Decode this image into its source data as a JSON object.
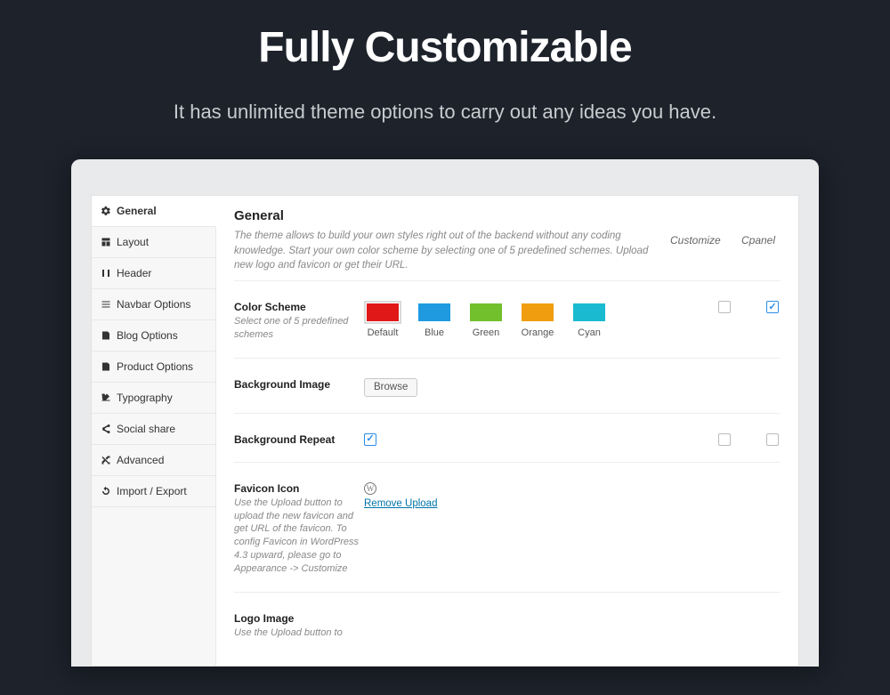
{
  "hero": {
    "title": "Fully Customizable",
    "subtitle": "It has unlimited theme options to carry out any ideas you have."
  },
  "sidebar": {
    "items": [
      {
        "label": "General"
      },
      {
        "label": "Layout"
      },
      {
        "label": "Header"
      },
      {
        "label": "Navbar Options"
      },
      {
        "label": "Blog Options"
      },
      {
        "label": "Product Options"
      },
      {
        "label": "Typography"
      },
      {
        "label": "Social share"
      },
      {
        "label": "Advanced"
      },
      {
        "label": "Import / Export"
      }
    ]
  },
  "content": {
    "heading": "General",
    "description": "The theme allows to build your own styles right out of the backend without any coding knowledge. Start your own color scheme by selecting one of 5 predefined schemes. Upload new logo and favicon or get their URL.",
    "col_customize": "Customize",
    "col_cpanel": "Cpanel",
    "color_scheme": {
      "title": "Color Scheme",
      "hint": "Select one of 5 predefined schemes",
      "swatches": [
        {
          "label": "Default",
          "color": "#e11818",
          "selected": true
        },
        {
          "label": "Blue",
          "color": "#1f9ae0"
        },
        {
          "label": "Green",
          "color": "#72c02c"
        },
        {
          "label": "Orange",
          "color": "#f09e0f"
        },
        {
          "label": "Cyan",
          "color": "#1abbd0"
        }
      ]
    },
    "bg_image": {
      "title": "Background Image",
      "browse": "Browse"
    },
    "bg_repeat": {
      "title": "Background Repeat"
    },
    "favicon": {
      "title": "Favicon Icon",
      "hint": "Use the Upload button to upload the new favicon and get URL of the favicon. To config Favicon in WordPress 4.3 upward, please go to Appearance -> Customize",
      "remove": "Remove Upload"
    },
    "logo": {
      "title": "Logo Image",
      "hint": "Use the Upload button to"
    }
  }
}
